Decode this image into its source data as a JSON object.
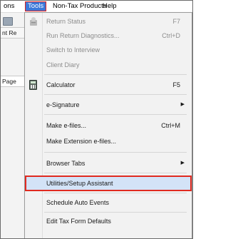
{
  "menubar": {
    "items": [
      "ons",
      "Tools",
      "Non-Tax Products",
      "Help"
    ]
  },
  "background": {
    "toolbar_label": "nt Re",
    "page_tab_label": "Page"
  },
  "tools_menu": {
    "items": [
      {
        "label": "Return Status",
        "shortcut": "F7",
        "enabled": false,
        "icon": "return-status-icon"
      },
      {
        "label": "Run Return Diagnostics...",
        "shortcut": "Ctrl+D",
        "enabled": false
      },
      {
        "label": "Switch to Interview",
        "shortcut": "",
        "enabled": false
      },
      {
        "label": "Client Diary",
        "shortcut": "",
        "enabled": false
      },
      {
        "label": "Calculator",
        "shortcut": "F5",
        "enabled": true,
        "icon": "calculator-icon"
      },
      {
        "label": "e-Signature",
        "shortcut": "",
        "enabled": true,
        "submenu": true
      },
      {
        "label": "Make e-files...",
        "shortcut": "Ctrl+M",
        "enabled": true
      },
      {
        "label": "Make Extension e-files...",
        "shortcut": "",
        "enabled": true
      },
      {
        "label": "Browser Tabs",
        "shortcut": "",
        "enabled": true,
        "submenu": true
      },
      {
        "label": "Utilities/Setup Assistant",
        "shortcut": "",
        "enabled": true,
        "highlighted": true
      },
      {
        "label": "Schedule Auto Events",
        "shortcut": "",
        "enabled": true
      },
      {
        "label": "Edit Tax Form Defaults",
        "shortcut": "",
        "enabled": true
      }
    ],
    "submenu_arrow": "▶"
  },
  "colors": {
    "menu_selected_bg": "#3c78d8",
    "highlight_border": "#e02a20",
    "highlight_bg": "#d3e3f7",
    "disabled_text": "#8d8d8d"
  }
}
